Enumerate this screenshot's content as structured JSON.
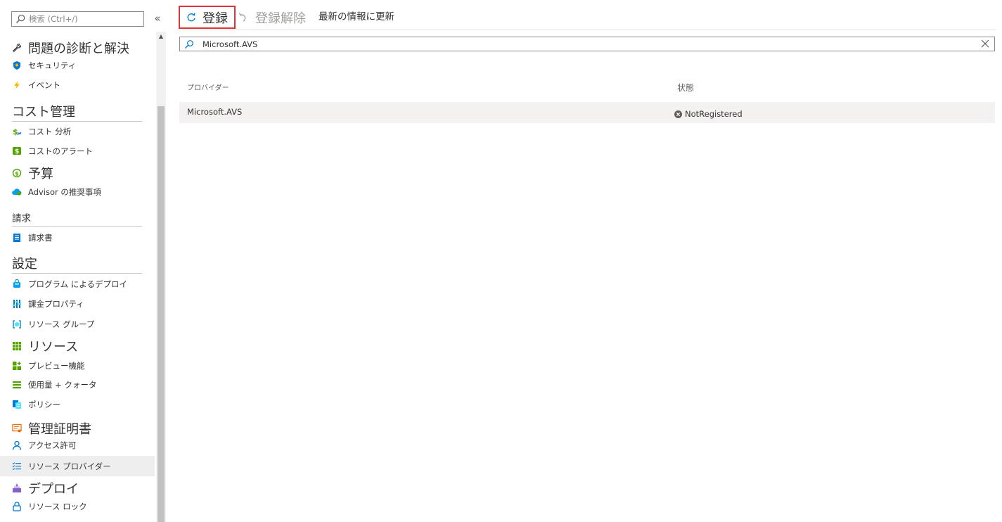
{
  "sidebar": {
    "search_placeholder": "検索 (Ctrl+/)",
    "collapse_label": "«",
    "items": [
      {
        "label": "問題の診断と解決",
        "icon": "wrench-icon"
      },
      {
        "label": "セキュリティ",
        "icon": "shield-icon"
      },
      {
        "label": "イベント",
        "icon": "lightning-icon"
      },
      {
        "label": "コスト 分析",
        "icon": "cost-analysis-icon"
      },
      {
        "label": "コストのアラート",
        "icon": "cost-alert-icon"
      },
      {
        "label": "予算",
        "icon": "budget-icon"
      },
      {
        "label": "Advisor の推奨事項",
        "icon": "advisor-cloud-icon"
      },
      {
        "label": "請求書",
        "icon": "invoice-icon"
      },
      {
        "label": "プログラム によるデプロイ",
        "icon": "bag-icon"
      },
      {
        "label": "課金プロパティ",
        "icon": "sliders-icon"
      },
      {
        "label": "リソース グループ",
        "icon": "resource-group-icon"
      },
      {
        "label": "リソース",
        "icon": "grid-icon"
      },
      {
        "label": "プレビュー機能",
        "icon": "preview-features-icon"
      },
      {
        "label": "使用量 + クォータ",
        "icon": "usage-quota-icon"
      },
      {
        "label": "ポリシー",
        "icon": "policy-icon"
      },
      {
        "label": "管理証明書",
        "icon": "certificate-icon"
      },
      {
        "label": "アクセス許可",
        "icon": "person-icon"
      },
      {
        "label": "リソース プロバイダー",
        "icon": "list-check-icon"
      },
      {
        "label": "デプロイ",
        "icon": "deploy-icon"
      },
      {
        "label": "リソース ロック",
        "icon": "lock-icon"
      }
    ],
    "sections": {
      "cost": "コスト管理",
      "billing": "請求",
      "settings": "設定"
    }
  },
  "toolbar": {
    "register_label": "登録",
    "unregister_label": "登録解除",
    "refresh_label": "最新の情報に更新"
  },
  "filter": {
    "value": "Microsoft.AVS"
  },
  "table": {
    "columns": [
      "プロバイダー",
      "状態"
    ],
    "rows": [
      {
        "provider": "Microsoft.AVS",
        "status": "NotRegistered"
      }
    ]
  },
  "colors": {
    "accent": "#0078d4",
    "highlight_border": "#e03434",
    "selected_bg": "#eeeeee"
  }
}
